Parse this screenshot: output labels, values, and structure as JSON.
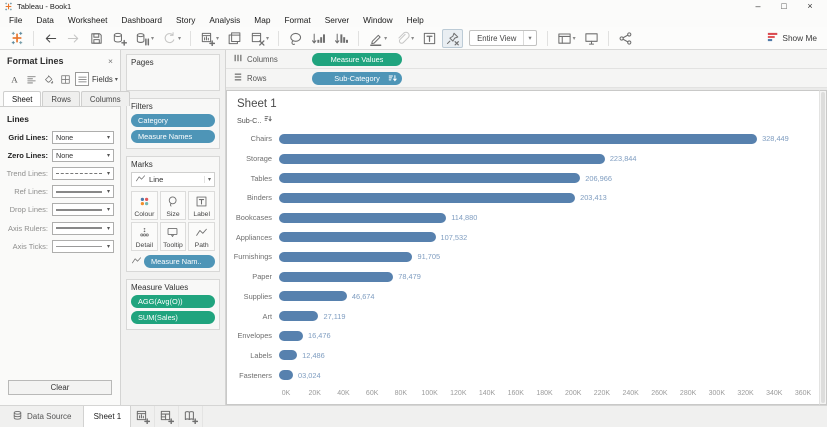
{
  "window": {
    "title": "Tableau - Book1",
    "controls": {
      "minimize": "–",
      "maximize": "□",
      "close": "×"
    }
  },
  "menu": {
    "items": [
      "File",
      "Data",
      "Worksheet",
      "Dashboard",
      "Story",
      "Analysis",
      "Map",
      "Format",
      "Server",
      "Window",
      "Help"
    ]
  },
  "toolbar": {
    "view_mode": "Entire View",
    "show_me_label": "Show Me",
    "items": [
      {
        "icon": "tableau-logo"
      },
      {
        "sep": true
      },
      {
        "icon": "undo"
      },
      {
        "icon": "redo",
        "disabled": true
      },
      {
        "icon": "save"
      },
      {
        "icon": "add-data-source"
      },
      {
        "icon": "pause-auto-updates",
        "dropdown": true
      },
      {
        "icon": "run-auto-updates",
        "dropdown": true,
        "disabled": true
      },
      {
        "sep": true
      },
      {
        "icon": "new-worksheet",
        "dropdown": true
      },
      {
        "icon": "duplicate-sheet"
      },
      {
        "icon": "clear-sheet",
        "dropdown": true
      },
      {
        "sep": true
      },
      {
        "icon": "group-members"
      },
      {
        "icon": "sort-ascending"
      },
      {
        "icon": "sort-descending"
      },
      {
        "sep": true
      },
      {
        "icon": "highlight",
        "dropdown": true
      },
      {
        "icon": "format-workbook",
        "dropdown": true,
        "disabled": true
      },
      {
        "icon": "show-mark-labels"
      },
      {
        "icon": "fix-axes",
        "pressed": true
      },
      {
        "view_selector": true
      },
      {
        "sep": true
      },
      {
        "icon": "show-hide-cards",
        "dropdown": true
      },
      {
        "icon": "presentation-mode"
      },
      {
        "sep": true
      },
      {
        "icon": "share-workbook"
      }
    ]
  },
  "format_panel": {
    "title": "Format Lines",
    "close_label": "×",
    "icon_buttons": [
      {
        "icon": "font"
      },
      {
        "icon": "alignment"
      },
      {
        "icon": "shading"
      },
      {
        "icon": "borders"
      },
      {
        "icon": "lines",
        "active": true
      }
    ],
    "fields_label": "Fields",
    "tabs": [
      "Sheet",
      "Rows",
      "Columns"
    ],
    "active_tab": "Sheet",
    "section_title": "Lines",
    "rows": [
      {
        "label": "Grid Lines:",
        "value": "None",
        "bold": true,
        "style": "text"
      },
      {
        "label": "Zero Lines:",
        "value": "None",
        "bold": true,
        "style": "text"
      },
      {
        "label": "Trend Lines:",
        "value": "",
        "bold": false,
        "style": "dashed"
      },
      {
        "label": "Ref Lines:",
        "value": "",
        "bold": false,
        "style": "solid"
      },
      {
        "label": "Drop Lines:",
        "value": "",
        "bold": false,
        "style": "solid"
      },
      {
        "label": "Axis Rulers:",
        "value": "",
        "bold": false,
        "style": "solid"
      },
      {
        "label": "Axis Ticks:",
        "value": "",
        "bold": false,
        "style": "thin"
      }
    ],
    "clear_button": "Clear"
  },
  "cards_panel": {
    "pages_title": "Pages",
    "filters_title": "Filters",
    "filter_pills": [
      {
        "label": "Category",
        "type": "dimension"
      },
      {
        "label": "Measure Names",
        "type": "dimension"
      }
    ],
    "marks_title": "Marks",
    "mark_type": "Line",
    "mark_buttons": [
      {
        "label": "Colour",
        "icon": "colour"
      },
      {
        "label": "Size",
        "icon": "size"
      },
      {
        "label": "Label",
        "icon": "label"
      },
      {
        "label": "Detail",
        "icon": "detail"
      },
      {
        "label": "Tooltip",
        "icon": "tooltip"
      },
      {
        "label": "Path",
        "icon": "path"
      }
    ],
    "marks_pill": {
      "label": "Measure Nam..",
      "type": "dimension"
    },
    "measure_values_title": "Measure Values",
    "measure_pills": [
      {
        "label": "AGG(Avg(O))",
        "type": "measure"
      },
      {
        "label": "SUM(Sales)",
        "type": "measure"
      }
    ]
  },
  "shelves": {
    "columns_label": "Columns",
    "columns_pills": [
      {
        "label": "Measure Values",
        "type": "measure"
      }
    ],
    "rows_label": "Rows",
    "rows_pills": [
      {
        "label": "Sub-Category",
        "type": "dimension",
        "sorted": true
      }
    ]
  },
  "sheet": {
    "title": "Sheet 1",
    "row_field_label": "Sub-C.."
  },
  "chart_data": {
    "type": "bar",
    "orientation": "horizontal",
    "title": "Sheet 1",
    "categories": [
      "Chairs",
      "Storage",
      "Tables",
      "Binders",
      "Bookcases",
      "Appliances",
      "Furnishings",
      "Paper",
      "Supplies",
      "Art",
      "Envelopes",
      "Labels",
      "Fasteners"
    ],
    "values": [
      328449,
      223844,
      206966,
      203413,
      114880,
      107532,
      91705,
      78479,
      46674,
      27119,
      16476,
      12486,
      3024
    ],
    "value_labels": [
      "328,449",
      "223,844",
      "206,966",
      "203,413",
      "114,880",
      "107,532",
      "91,705",
      "78,479",
      "46,674",
      "27,119",
      "16,476",
      "12,486",
      "03,024"
    ],
    "x_ticks": [
      "0K",
      "20K",
      "40K",
      "60K",
      "80K",
      "100K",
      "120K",
      "140K",
      "160K",
      "180K",
      "200K",
      "220K",
      "240K",
      "260K",
      "280K",
      "300K",
      "320K",
      "340K",
      "360K"
    ],
    "xlim": [
      0,
      360000
    ],
    "xlabel": "",
    "ylabel": "Sub-Category",
    "grid": false,
    "legend": false,
    "bar_color": "#5781ae",
    "value_label_color": "#7f9dc0"
  },
  "statusbar": {
    "data_source_label": "Data Source",
    "sheet_tab": "Sheet 1"
  },
  "colors": {
    "dimension_pill": "#4e95b7",
    "measure_pill": "#20a47e",
    "bar": "#5781ae",
    "accent_orange": "#e8762d"
  }
}
